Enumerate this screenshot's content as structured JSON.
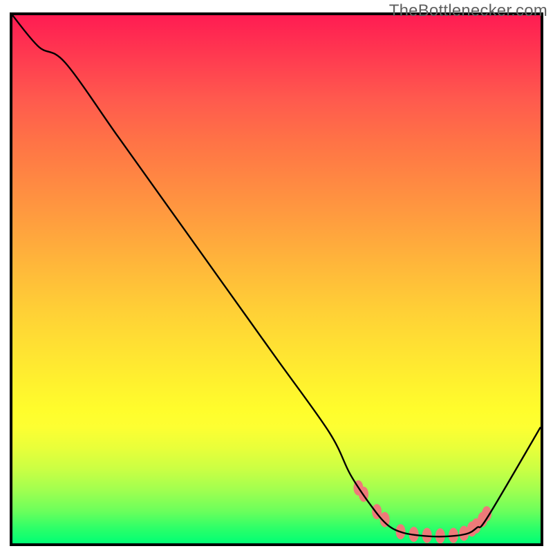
{
  "watermark": "TheBottlenecker.com",
  "chart_data": {
    "type": "line",
    "title": "",
    "xlabel": "",
    "ylabel": "",
    "xlim": [
      0,
      100
    ],
    "ylim": [
      0,
      100
    ],
    "curve": {
      "x": [
        0,
        5,
        10,
        20,
        30,
        40,
        50,
        60,
        64,
        68,
        71,
        74,
        78,
        82,
        86,
        88,
        90,
        100
      ],
      "y": [
        100,
        94,
        91,
        77,
        63,
        49,
        35,
        21,
        13,
        7,
        3.5,
        2.0,
        1.4,
        1.3,
        1.8,
        3.0,
        5.0,
        22
      ]
    },
    "markers": {
      "x": [
        65.5,
        66.5,
        69.0,
        70.5,
        73.5,
        76.0,
        78.5,
        81.0,
        83.5,
        85.5,
        87.0,
        87.8,
        89.0,
        89.8
      ],
      "y": [
        10.5,
        9.3,
        6.0,
        4.5,
        2.2,
        1.7,
        1.5,
        1.4,
        1.5,
        1.9,
        2.7,
        3.3,
        4.5,
        5.6
      ],
      "color": "#ee7a79",
      "rx": 7,
      "ry": 11
    },
    "gradient_stops": [
      {
        "pos": 0,
        "color": "#ff1c52"
      },
      {
        "pos": 50,
        "color": "#ffc238"
      },
      {
        "pos": 75,
        "color": "#fffd2c"
      },
      {
        "pos": 100,
        "color": "#00ff74"
      }
    ]
  }
}
